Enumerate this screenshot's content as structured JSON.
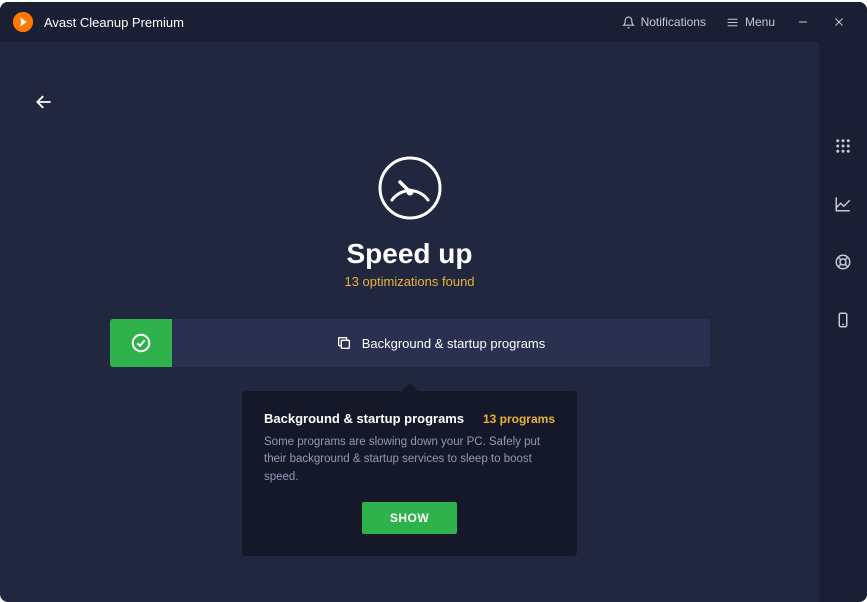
{
  "titlebar": {
    "app_name": "Avast Cleanup Premium",
    "notifications_label": "Notifications",
    "menu_label": "Menu"
  },
  "main": {
    "title": "Speed up",
    "subtitle": "13 optimizations found",
    "category": {
      "label": "Background & startup programs"
    }
  },
  "popover": {
    "title": "Background & startup programs",
    "count": "13 programs",
    "description": "Some programs are slowing down your PC. Safely put their background & startup services to sleep to boost speed.",
    "show_label": "SHOW"
  },
  "colors": {
    "accent_orange": "#ff7800",
    "accent_yellow": "#eab23a",
    "success_green": "#2fb24c",
    "bg_main": "#21273f",
    "bg_dark": "#1a1f33",
    "bg_tile": "#2a3150",
    "bg_popover": "#141828"
  }
}
